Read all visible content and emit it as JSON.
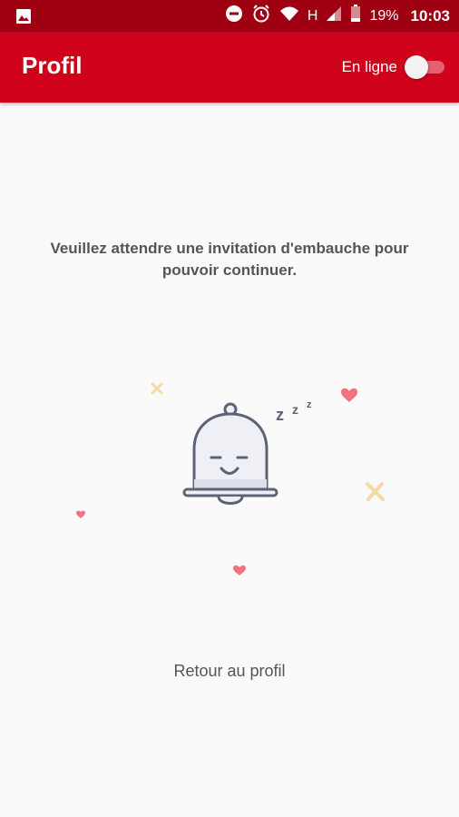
{
  "status_bar": {
    "battery_percent": "19%",
    "time": "10:03",
    "network_type": "H",
    "icons": [
      "gallery-icon",
      "do-not-disturb-icon",
      "alarm-icon",
      "wifi-icon",
      "signal-icon",
      "battery-icon"
    ]
  },
  "app_bar": {
    "title": "Profil",
    "online_label": "En ligne",
    "online_enabled": false
  },
  "main": {
    "message": "Veuillez attendre une invitation d'embauche pour pouvoir continuer.",
    "illustration": {
      "icon": "sleeping-bell-icon",
      "zzz": "z z z"
    },
    "back_link": "Retour au profil"
  },
  "colors": {
    "status_bar": "#9e0012",
    "app_bar": "#d0021b",
    "background": "#fafafa",
    "text": "#555555",
    "heart": "#f0737f",
    "sparkle": "#f7d9a6"
  }
}
